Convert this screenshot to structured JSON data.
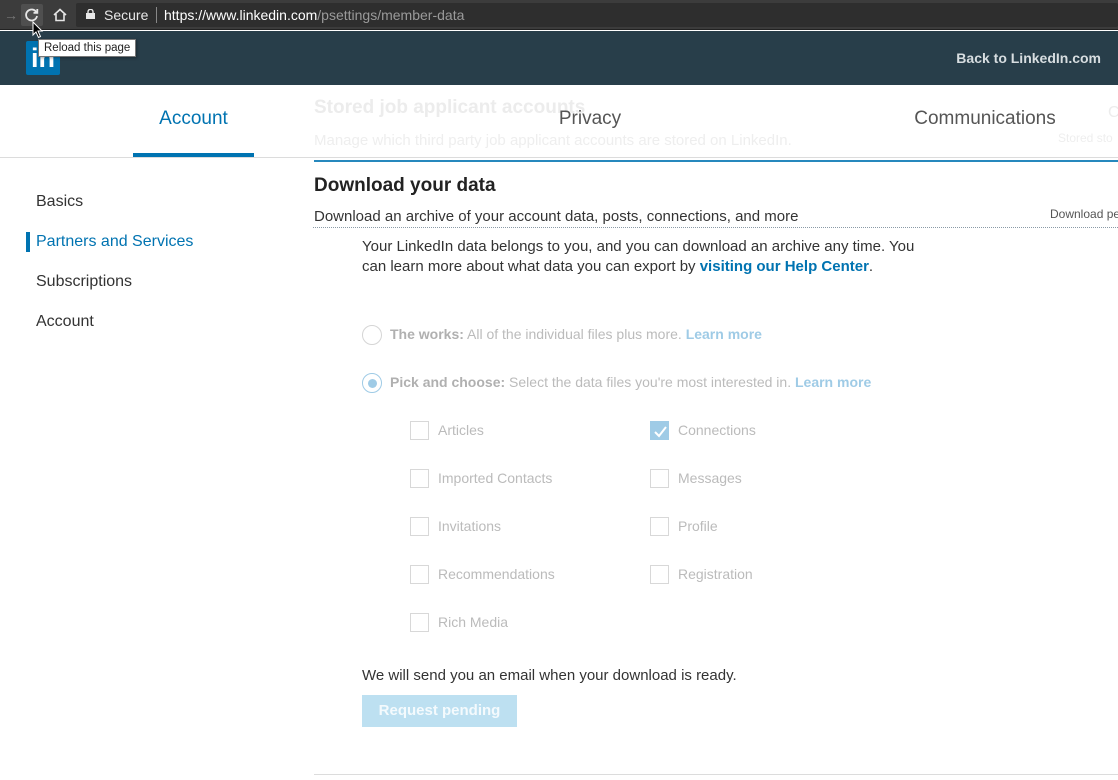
{
  "browser": {
    "secure_label": "Secure",
    "url_host": "https://www.linkedin.com",
    "url_path": "/psettings/member-data",
    "tooltip": "Reload this page"
  },
  "header": {
    "logo_text": "in",
    "back_link": "Back to LinkedIn.com"
  },
  "tabs": [
    {
      "label": "Account",
      "active": true
    },
    {
      "label": "Privacy",
      "active": false
    },
    {
      "label": "Communications",
      "active": false
    }
  ],
  "ghost": {
    "title": "Stored job applicant accounts",
    "subtitle": "Manage which third party job applicant accounts are stored on LinkedIn.",
    "right_top": "C",
    "right_sub": "Stored sto"
  },
  "sidebar": {
    "items": [
      {
        "label": "Basics",
        "active": false
      },
      {
        "label": "Partners and Services",
        "active": true
      },
      {
        "label": "Subscriptions",
        "active": false
      },
      {
        "label": "Account",
        "active": false
      }
    ]
  },
  "section": {
    "title": "Download your data",
    "description": "Download an archive of your account data, posts, connections, and more",
    "right_text": "Download pe"
  },
  "intro": {
    "text_before": "Your LinkedIn data belongs to you, and you can download an archive any time. You can learn more about what data you can export by ",
    "link": "visiting our Help Center",
    "text_after": "."
  },
  "options": {
    "works": {
      "label": "The works:",
      "desc": " All of the individual files plus more. ",
      "learn": "Learn more",
      "selected": false
    },
    "pick": {
      "label": "Pick and choose:",
      "desc": " Select the data files you're most interested in. ",
      "learn": "Learn more",
      "selected": true
    }
  },
  "checkboxes": {
    "left": [
      {
        "label": "Articles",
        "checked": false
      },
      {
        "label": "Imported Contacts",
        "checked": false
      },
      {
        "label": "Invitations",
        "checked": false
      },
      {
        "label": "Recommendations",
        "checked": false
      },
      {
        "label": "Rich Media",
        "checked": false
      }
    ],
    "right": [
      {
        "label": "Connections",
        "checked": true
      },
      {
        "label": "Messages",
        "checked": false
      },
      {
        "label": "Profile",
        "checked": false
      },
      {
        "label": "Registration",
        "checked": false
      }
    ]
  },
  "footer": {
    "note": "We will send you an email when your download is ready.",
    "button": "Request pending"
  },
  "colors": {
    "brand": "#0073b1",
    "header_bg": "#283e4a",
    "disabled_blue": "#9fcbe6"
  }
}
